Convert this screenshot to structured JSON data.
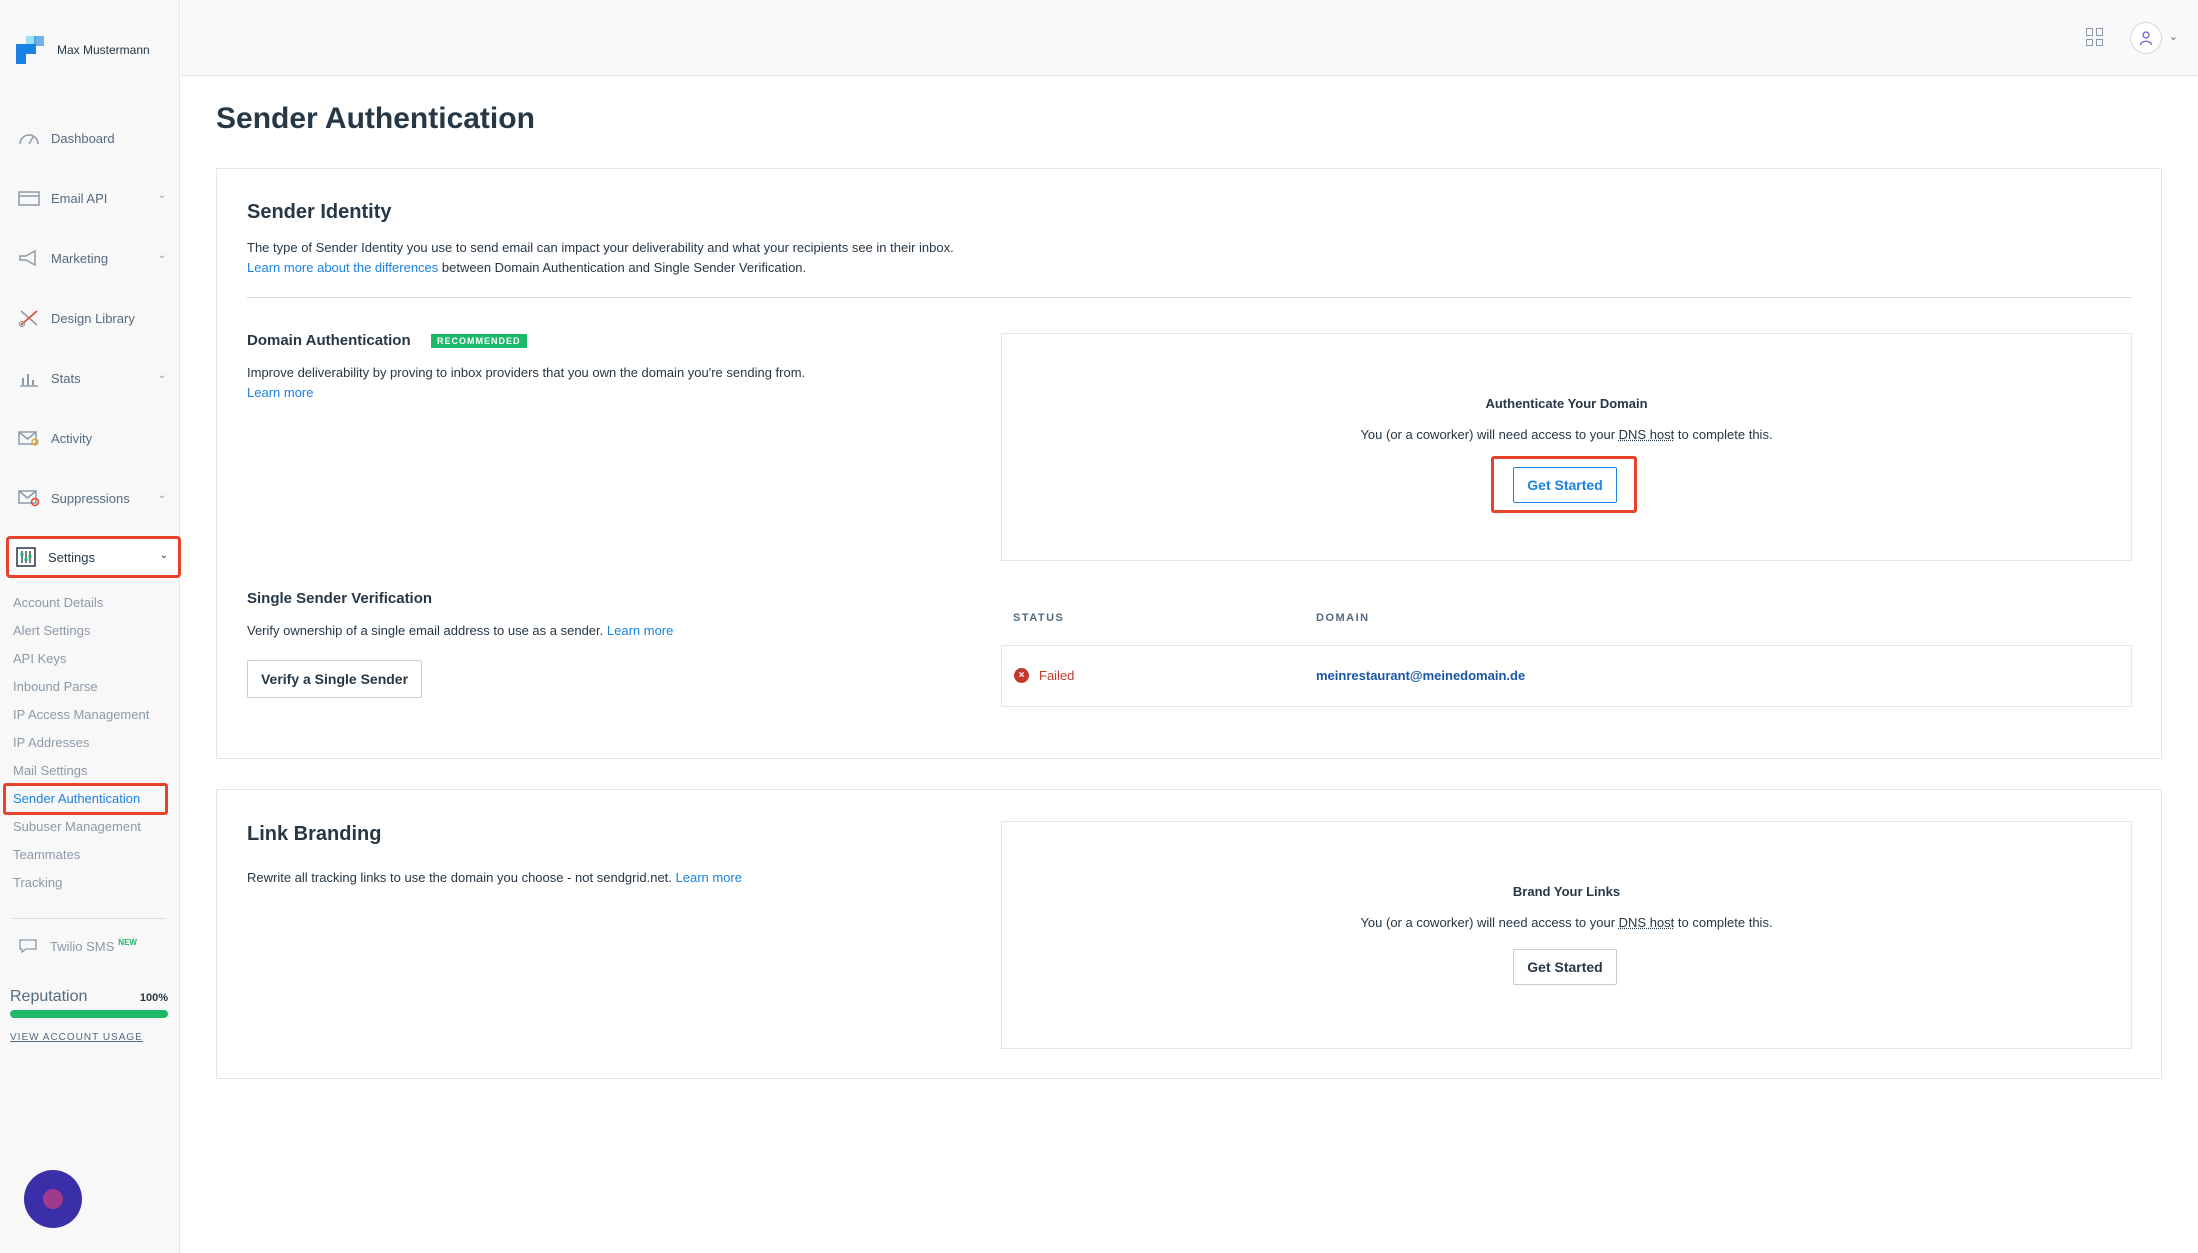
{
  "sidebar": {
    "account_name": "Max Mustermann",
    "nav": [
      {
        "label": "Dashboard",
        "icon": "dashboard-icon",
        "has_children": false
      },
      {
        "label": "Email API",
        "icon": "email-api-icon",
        "has_children": true
      },
      {
        "label": "Marketing",
        "icon": "megaphone-icon",
        "has_children": true
      },
      {
        "label": "Design Library",
        "icon": "design-library-icon",
        "has_children": false
      },
      {
        "label": "Stats",
        "icon": "stats-icon",
        "has_children": true
      },
      {
        "label": "Activity",
        "icon": "activity-icon",
        "has_children": false
      },
      {
        "label": "Suppressions",
        "icon": "suppressions-icon",
        "has_children": true
      },
      {
        "label": "Settings",
        "icon": "settings-icon",
        "has_children": true,
        "active": true
      }
    ],
    "settings_items": [
      "Account Details",
      "Alert Settings",
      "API Keys",
      "Inbound Parse",
      "IP Access Management",
      "IP Addresses",
      "Mail Settings",
      "Sender Authentication",
      "Subuser Management",
      "Teammates",
      "Tracking"
    ],
    "current_item": "Sender Authentication",
    "twilio_sms": {
      "label": "Twilio SMS",
      "badge": "NEW"
    },
    "reputation": {
      "label": "Reputation",
      "value": "100%",
      "fraction": 1.0
    },
    "usage_link": "VIEW ACCOUNT USAGE"
  },
  "header": {
    "title": "Sender Authentication"
  },
  "sender_identity": {
    "title": "Sender Identity",
    "description": "The type of Sender Identity you use to send email can impact your deliverability and what your recipients see in their inbox.",
    "learn_link": "Learn more about the differences",
    "learn_suffix": " between Domain Authentication and Single Sender Verification."
  },
  "domain_auth": {
    "title": "Domain Authentication",
    "badge": "RECOMMENDED",
    "description": "Improve deliverability by proving to inbox providers that you own the domain you're sending from.",
    "learn_more": "Learn more",
    "box_title": "Authenticate Your Domain",
    "box_text_pre": "You (or a coworker) will need access to your ",
    "box_text_dns": "DNS host",
    "box_text_post": " to complete this.",
    "button": "Get Started"
  },
  "single_sender": {
    "title": "Single Sender Verification",
    "description": "Verify ownership of a single email address to use as a sender. ",
    "learn_more": "Learn more",
    "button": "Verify a Single Sender",
    "columns": [
      "STATUS",
      "DOMAIN"
    ],
    "rows": [
      {
        "status": "Failed",
        "domain": "meinrestaurant@meinedomain.de"
      }
    ]
  },
  "link_branding": {
    "title": "Link Branding",
    "description": "Rewrite all tracking links to use the domain you choose - not sendgrid.net. ",
    "learn_more": "Learn more",
    "box_title": "Brand Your Links",
    "box_text_pre": "You (or a coworker) will need access to your ",
    "box_text_dns": "DNS host",
    "box_text_post": " to complete this.",
    "button": "Get Started"
  },
  "colors": {
    "accent": "#1a82e2",
    "highlight": "#e8412c",
    "success": "#1db86a",
    "error": "#c0392b",
    "chat": "#3a2fa8"
  }
}
